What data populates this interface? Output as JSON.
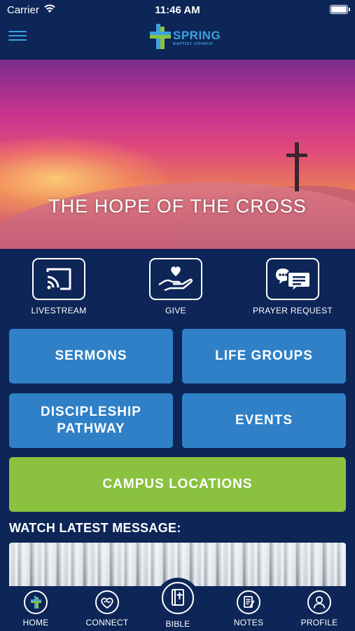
{
  "status": {
    "carrier": "Carrier",
    "time": "11:46 AM"
  },
  "header": {
    "logo_title": "SPRING",
    "logo_subtitle": "BAPTIST CHURCH",
    "brand_color": "#3da3e0"
  },
  "hero": {
    "title": "THE HOPE OF THE CROSS",
    "slide_count": 6,
    "active_slide": 1
  },
  "quick_actions": [
    {
      "label": "LIVESTREAM",
      "icon": "cast-icon"
    },
    {
      "label": "GIVE",
      "icon": "heart-hand-icon"
    },
    {
      "label": "PRAYER REQUEST",
      "icon": "chat-bubbles-icon"
    }
  ],
  "buttons": {
    "sermons": "SERMONS",
    "life_groups": "LIFE GROUPS",
    "discipleship_line1": "DISCIPLESHIP",
    "discipleship_line2": "PATHWAY",
    "events": "EVENTS",
    "campus_locations": "CAMPUS LOCATIONS"
  },
  "colors": {
    "background": "#0d2557",
    "button_blue": "#2f80c7",
    "button_green": "#8ac240"
  },
  "latest": {
    "title": "WATCH LATEST MESSAGE:"
  },
  "tabs": [
    {
      "label": "HOME",
      "icon": "home-cross-icon"
    },
    {
      "label": "CONNECT",
      "icon": "heart-handshake-icon"
    },
    {
      "label": "BIBLE",
      "icon": "bible-icon"
    },
    {
      "label": "NOTES",
      "icon": "notes-icon"
    },
    {
      "label": "PROFILE",
      "icon": "profile-icon"
    }
  ]
}
